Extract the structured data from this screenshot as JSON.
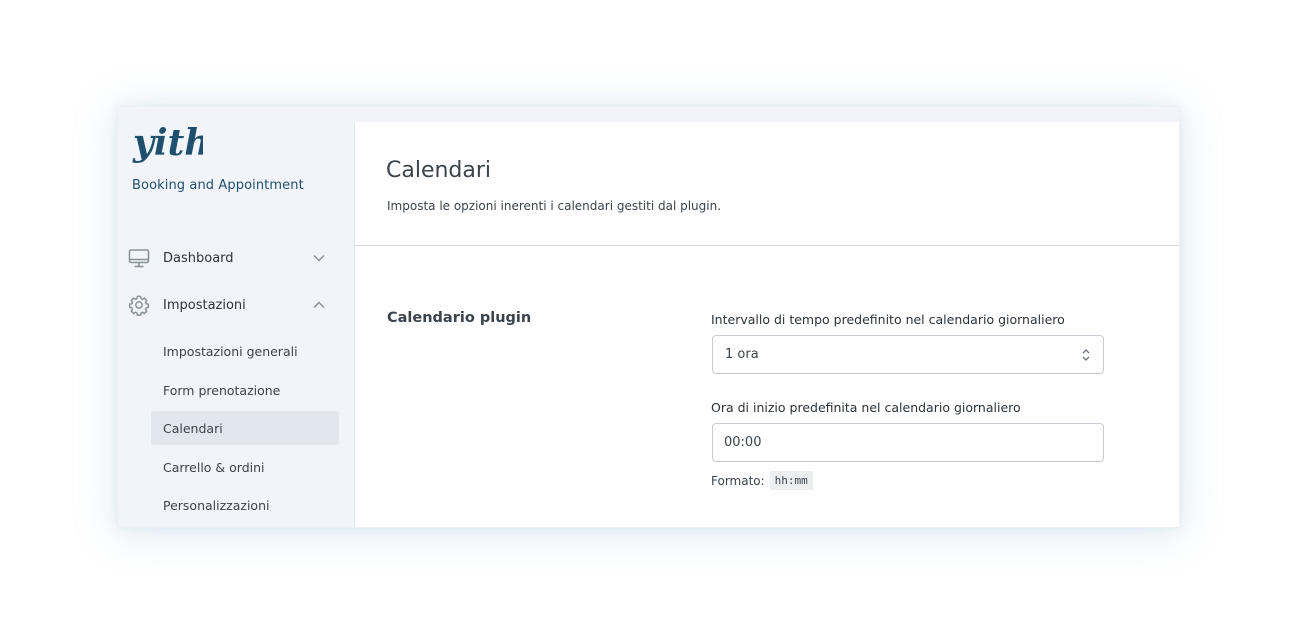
{
  "brand": {
    "logo_text": "yith",
    "app_name": "Booking and Appointment",
    "logo_color": "#1f4f6e"
  },
  "sidebar": {
    "items": [
      {
        "label": "Dashboard",
        "icon": "monitor-icon",
        "expanded": false
      },
      {
        "label": "Impostazioni",
        "icon": "gear-icon",
        "expanded": true
      }
    ],
    "subitems": [
      {
        "label": "Impostazioni generali",
        "active": false
      },
      {
        "label": "Form prenotazione",
        "active": false
      },
      {
        "label": "Calendari",
        "active": true
      },
      {
        "label": "Carrello & ordini",
        "active": false
      },
      {
        "label": "Personalizzazioni",
        "active": false
      }
    ]
  },
  "main": {
    "title": "Calendari",
    "description": "Imposta le opzioni inerenti i calendari gestiti dal plugin.",
    "section_title": "Calendario plugin",
    "fields": [
      {
        "label": "Intervallo di tempo predefinito nel calendario giornaliero",
        "type": "select",
        "value": "1 ora"
      },
      {
        "label": "Ora di inizio predefinita nel calendario giornaliero",
        "type": "text",
        "value": "00:00",
        "help_prefix": "Formato:",
        "help_code": "hh:mm"
      }
    ]
  }
}
